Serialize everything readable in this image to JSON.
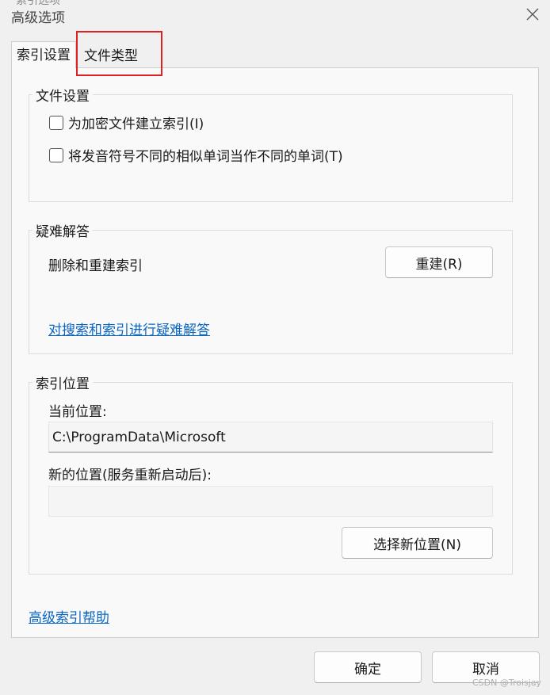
{
  "window": {
    "title": "高级选项",
    "background_title": "索引选项"
  },
  "tabs": [
    {
      "label": "索引设置",
      "selected": true
    },
    {
      "label": "文件类型",
      "selected": false
    }
  ],
  "file_settings": {
    "legend": "文件设置",
    "option_encrypt": {
      "label": "为加密文件建立索引(I)",
      "checked": false
    },
    "option_diacritics": {
      "label": "将发音符号不同的相似单词当作不同的单词(T)",
      "checked": false
    }
  },
  "troubleshoot": {
    "legend": "疑难解答",
    "rebuild_text": "删除和重建索引",
    "rebuild_button": "重建(R)",
    "link": "对搜索和索引进行疑难解答"
  },
  "index_location": {
    "legend": "索引位置",
    "current_label": "当前位置:",
    "current_value": "C:\\ProgramData\\Microsoft",
    "new_label": "新的位置(服务重新启动后):",
    "new_value": "",
    "select_button": "选择新位置(N)"
  },
  "help_link": "高级索引帮助",
  "footer": {
    "ok": "确定",
    "cancel": "取消"
  },
  "watermark": "CSDN @Troisjay",
  "colors": {
    "highlight_box": "#e02020",
    "link": "#0b66c3"
  },
  "icons": {
    "close": "close-icon"
  }
}
